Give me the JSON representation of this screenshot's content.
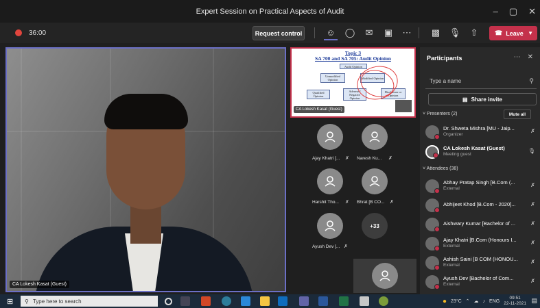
{
  "window": {
    "title": "Expert Session on Practical Aspects of Audit"
  },
  "toolbar": {
    "timer": "36:00",
    "request_control": "Request control",
    "leave": "Leave"
  },
  "stage": {
    "name": "CA Lokesh Kasat (Guest)"
  },
  "slide": {
    "title_line1": "Topic 3",
    "title_line2": "SA 700 and SA 705: Audit Opinion",
    "boxes": [
      "Audit Opinion",
      "Unmodified Opinion",
      "Modified Opinion",
      "Qualified Opinion",
      "Adverse / Negative Opinion",
      "Disclaimer or Opinion"
    ],
    "presenter": "CA Lokesh Kasat (Guest)"
  },
  "tiles": [
    {
      "name": "Ajay Khatri [..."
    },
    {
      "name": "Naresh Ku..."
    },
    {
      "name": "Harshit Tho..."
    },
    {
      "name": "Bhrat [B CO..."
    },
    {
      "name": "Ayush Dev [..."
    }
  ],
  "overflow_count": "+33",
  "panel": {
    "title": "Participants",
    "search_placeholder": "Type a name",
    "share_invite": "Share invite",
    "presenters_header": "Presenters (2)",
    "mute_all": "Mute all",
    "attendees_header": "Attendees (38)",
    "presenters": [
      {
        "name": "Dr. Shweta Mishra [MU - Jaip...",
        "role": "Organizer"
      },
      {
        "name": "CA Lokesh Kasat (Guest)",
        "role": "Meeting guest"
      }
    ],
    "attendees": [
      {
        "name": "Abhay Pratap Singh [B.Com (...",
        "role": "External"
      },
      {
        "name": "Abhijeet Khod [B.Com - 2020]...",
        "role": ""
      },
      {
        "name": "Aishwary Kumar [Bachelor of ...",
        "role": ""
      },
      {
        "name": "Ajay Khatri [B.Com (Honours I...",
        "role": "External"
      },
      {
        "name": "Ashish Saini [B COM (HONOU...",
        "role": "External"
      },
      {
        "name": "Ayush Dev [Bachelor of Com...",
        "role": "External"
      }
    ]
  },
  "taskbar": {
    "search_placeholder": "Type here to search",
    "temperature": "23°C",
    "lang": "ENG",
    "time": "09:51",
    "date": "22-11-2021"
  },
  "colors": {
    "accent": "#6b6fc6",
    "leave": "#c4314b",
    "record": "#e0453d"
  }
}
